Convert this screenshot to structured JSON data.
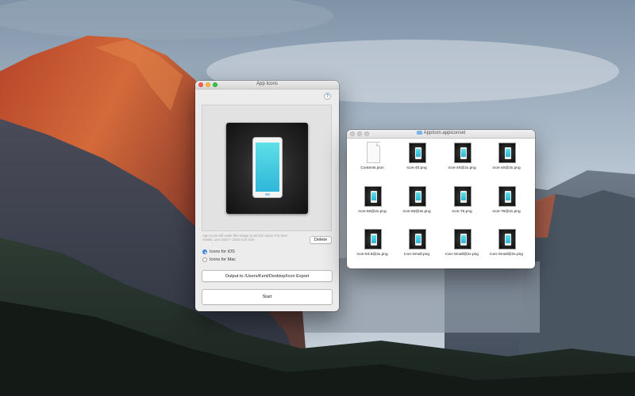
{
  "app_window": {
    "title": "App Icons",
    "help_label": "?",
    "hint_text": "App Icons will scale this image to all icon sizes. For best results, use 1024 × 1024 icon size.",
    "delete_label": "Delete",
    "radio_ios_label": "Icons for iOS",
    "radio_mac_label": "Icons for Mac",
    "selected_option": "Icons for iOS",
    "output_label": "Output to /Users/Kent/Desktop/Icon Export",
    "start_label": "Start"
  },
  "finder_window": {
    "title": "AppIcon.appiconset",
    "files": [
      {
        "name": "Contents.json",
        "kind": "json"
      },
      {
        "name": "Icon-40.png",
        "kind": "png"
      },
      {
        "name": "Icon-40@2x.png",
        "kind": "png"
      },
      {
        "name": "Icon-40@3x.png",
        "kind": "png"
      },
      {
        "name": "Icon-60@2x.png",
        "kind": "png"
      },
      {
        "name": "Icon-60@3x.png",
        "kind": "png"
      },
      {
        "name": "Icon-76.png",
        "kind": "png"
      },
      {
        "name": "Icon-76@2x.png",
        "kind": "png"
      },
      {
        "name": "Icon-83.5@2x.png",
        "kind": "png"
      },
      {
        "name": "Icon-Small.png",
        "kind": "png"
      },
      {
        "name": "Icon-Small@2x.png",
        "kind": "png"
      },
      {
        "name": "Icon-Small@3x.png",
        "kind": "png"
      }
    ]
  },
  "colors": {
    "accent": "#4a90e2",
    "icon_gradient_top": "#5ee0e8",
    "icon_gradient_bottom": "#2fb6d9"
  }
}
